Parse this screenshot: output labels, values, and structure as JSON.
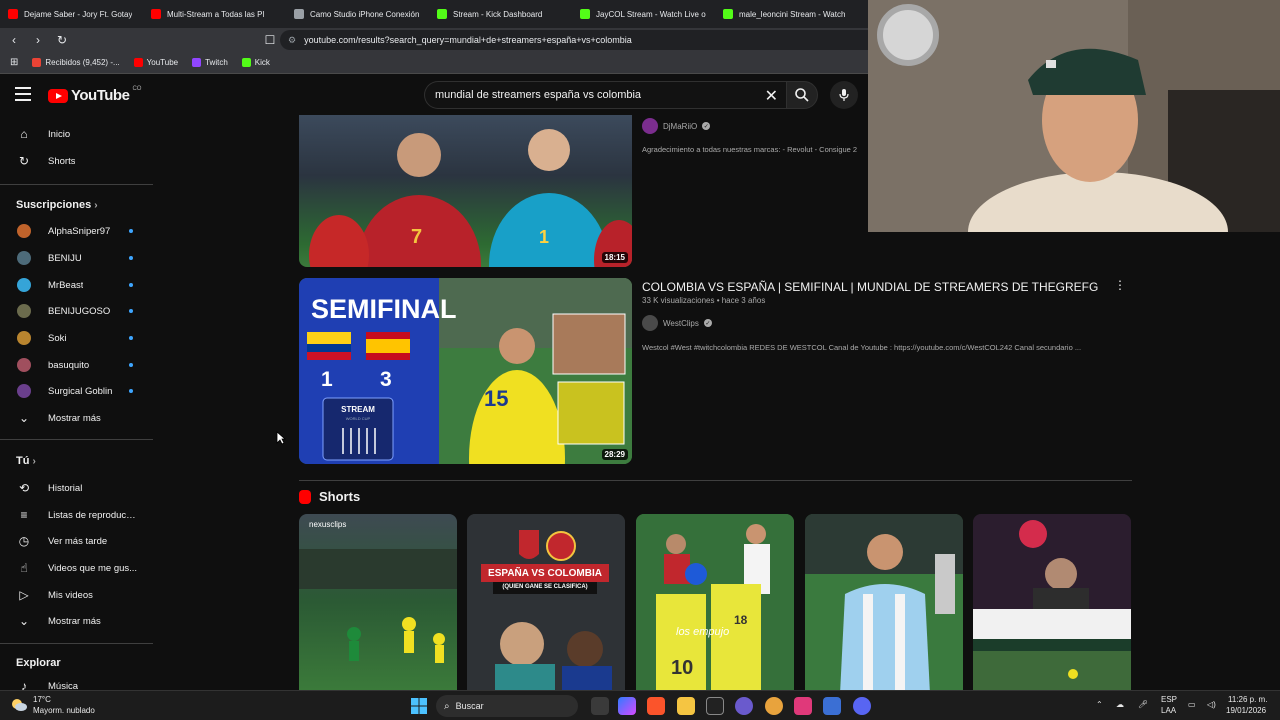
{
  "browser": {
    "tabs": [
      {
        "title": "Dejame Saber - Jory Ft. Gotay",
        "color": "#ff0000"
      },
      {
        "title": "Multi-Stream a Todas las Pl",
        "color": "#ff0000"
      },
      {
        "title": "Camo Studio iPhone Conexión",
        "color": "#9aa0a6"
      },
      {
        "title": "Stream - Kick Dashboard",
        "color": "#53fc18"
      },
      {
        "title": "JayCOL Stream - Watch Live o",
        "color": "#53fc18"
      },
      {
        "title": "male_leoncini Stream - Watch",
        "color": "#53fc18"
      }
    ],
    "url": "youtube.com/results?search_query=mundial+de+streamers+españa+vs+colombia",
    "bookmarks": [
      {
        "label": "Recibidos (9,452) -...",
        "color": "#ea4335"
      },
      {
        "label": "YouTube",
        "color": "#ff0000"
      },
      {
        "label": "Twitch",
        "color": "#9146ff"
      },
      {
        "label": "Kick",
        "color": "#53fc18"
      }
    ]
  },
  "header": {
    "logo_text": "YouTube",
    "country_code": "CO",
    "search_value": "mundial de streamers españa vs colombia"
  },
  "sidebar": {
    "main": [
      {
        "label": "Inicio",
        "icon": "home-icon",
        "glyph": "⌂"
      },
      {
        "label": "Shorts",
        "icon": "shorts-icon",
        "glyph": "↻"
      }
    ],
    "subscriptions_heading": "Suscripciones",
    "subscriptions": [
      {
        "label": "AlphaSniper97",
        "color": "#c0632b"
      },
      {
        "label": "BENIJU",
        "color": "#4d6b7a"
      },
      {
        "label": "MrBeast",
        "color": "#35a4d8"
      },
      {
        "label": "BENIJUGOSO",
        "color": "#6b6b4d"
      },
      {
        "label": "Soki",
        "color": "#b9852f"
      },
      {
        "label": "basuquito",
        "color": "#a04f5e"
      },
      {
        "label": "Surgical Goblin",
        "color": "#6a3f8c"
      }
    ],
    "show_more": "Mostrar más",
    "you_heading": "Tú",
    "you": [
      {
        "label": "Historial",
        "icon": "history-icon",
        "glyph": "⟲"
      },
      {
        "label": "Listas de reproducc...",
        "icon": "playlist-icon",
        "glyph": "≡"
      },
      {
        "label": "Ver más tarde",
        "icon": "clock-icon",
        "glyph": "◷"
      },
      {
        "label": "Videos que me gus...",
        "icon": "thumbs-up-icon",
        "glyph": "👍"
      },
      {
        "label": "Mis videos",
        "icon": "video-icon",
        "glyph": "▶"
      }
    ],
    "show_more_2": "Mostrar más",
    "explore_heading": "Explorar",
    "explore": [
      {
        "label": "Música",
        "icon": "music-icon",
        "glyph": "♪"
      }
    ]
  },
  "results": [
    {
      "title": "",
      "channel": "DjMaRiiO",
      "channel_color": "#7b2d8e",
      "description": "Agradecimiento a todas nuestras marcas: - Revolut - Consigue 2",
      "duration": "18:15"
    },
    {
      "title": "COLOMBIA VS ESPAÑA | SEMIFINAL | MUNDIAL DE STREAMERS DE THEGREFG",
      "meta": "33 K visualizaciones • hace 3 años",
      "channel": "WestClips",
      "channel_color": "#444",
      "description": "Westcol #West #twitchcolombia REDES DE WESTCOL Canal de Youtube : https://youtube.com/c/WestCOL242 Canal secundario ...",
      "duration": "28:29",
      "thumb_text": {
        "headline": "SEMIFINAL",
        "score_left": "1",
        "score_right": "3",
        "logo_line1": "STREAM",
        "logo_line2": "WORLD CUP",
        "jersey": "15"
      }
    }
  ],
  "shorts": {
    "heading": "Shorts",
    "items": [
      {
        "overlay": "nexusclips"
      },
      {
        "overlay": "ESPAÑA VS COLOMBIA",
        "sub": "(QUIEN GANE SE CLASIFICA)"
      },
      {
        "overlay": "los empujo"
      },
      {
        "overlay": ""
      },
      {
        "overlay": ""
      }
    ]
  },
  "taskbar": {
    "weather_temp": "17°C",
    "weather_desc": "Mayorm. nublado",
    "search_label": "Buscar",
    "lang_top": "ESP",
    "lang_bottom": "LAA",
    "time": "11:26 p. m.",
    "date": "19/01/2026"
  },
  "colors": {
    "accent_red": "#ff0000",
    "verified_blue": "#3ea6ff",
    "background": "#0f0f0f"
  }
}
